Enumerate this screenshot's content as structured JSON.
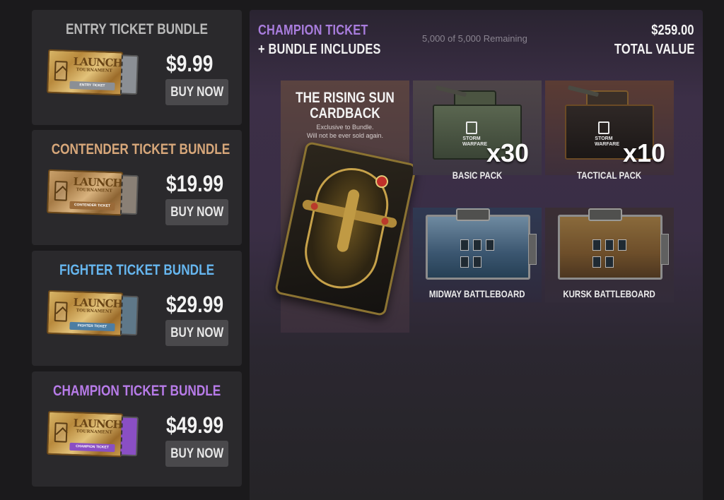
{
  "bundles": [
    {
      "title": "ENTRY TICKET BUNDLE",
      "price": "$9.99",
      "buy_label": "BUY NOW",
      "title_color": "#b9b9b9",
      "ticket": {
        "logo": "LAUNCH",
        "sub": "TOURNAMENT",
        "band": "ENTRY TICKET",
        "band_color": "#8b8f95"
      }
    },
    {
      "title": "CONTENDER TICKET BUNDLE",
      "price": "$19.99",
      "buy_label": "BUY NOW",
      "title_color": "#d7a77a",
      "ticket": {
        "logo": "LAUNCH",
        "sub": "TOURNAMENT",
        "band": "CONTENDER TICKET",
        "band_color": "#9a6a38"
      }
    },
    {
      "title": "FIGHTER TICKET BUNDLE",
      "price": "$29.99",
      "buy_label": "BUY NOW",
      "title_color": "#66b6ef",
      "ticket": {
        "logo": "LAUNCH",
        "sub": "TOURNAMENT",
        "band": "FIGHTER TICKET",
        "band_color": "#4c7da3"
      }
    },
    {
      "title": "CHAMPION TICKET BUNDLE",
      "price": "$49.99",
      "buy_label": "BUY NOW",
      "title_color": "#b77be8",
      "ticket": {
        "logo": "LAUNCH",
        "sub": "TOURNAMENT",
        "band": "CHAMPION TICKET",
        "band_color": "#8a4fc4"
      }
    }
  ],
  "detail": {
    "title": "CHAMPION TICKET",
    "subtitle": "+ BUNDLE INCLUDES",
    "remaining": "5,000 of 5,000 Remaining",
    "value": "$259.00",
    "value_label": "TOTAL VALUE",
    "cardback": {
      "title_line1": "THE RISING SUN",
      "title_line2": "CARDBACK",
      "note_line1": "Exclusive to Bundle.",
      "note_line2": "Will not be ever sold again."
    },
    "items": [
      {
        "label": "BASIC PACK",
        "multiplier": "x30",
        "crate_text_1": "STORM",
        "crate_text_2": "WARFARE"
      },
      {
        "label": "TACTICAL PACK",
        "multiplier": "x10",
        "crate_text_1": "STORM",
        "crate_text_2": "WARFARE"
      },
      {
        "label": "MIDWAY BATTLEBOARD"
      },
      {
        "label": "KURSK BATTLEBOARD"
      }
    ]
  },
  "colors": {
    "accent_purple": "#a97ddd",
    "card_bg": "#2a292c",
    "button_bg": "#4a494c"
  }
}
